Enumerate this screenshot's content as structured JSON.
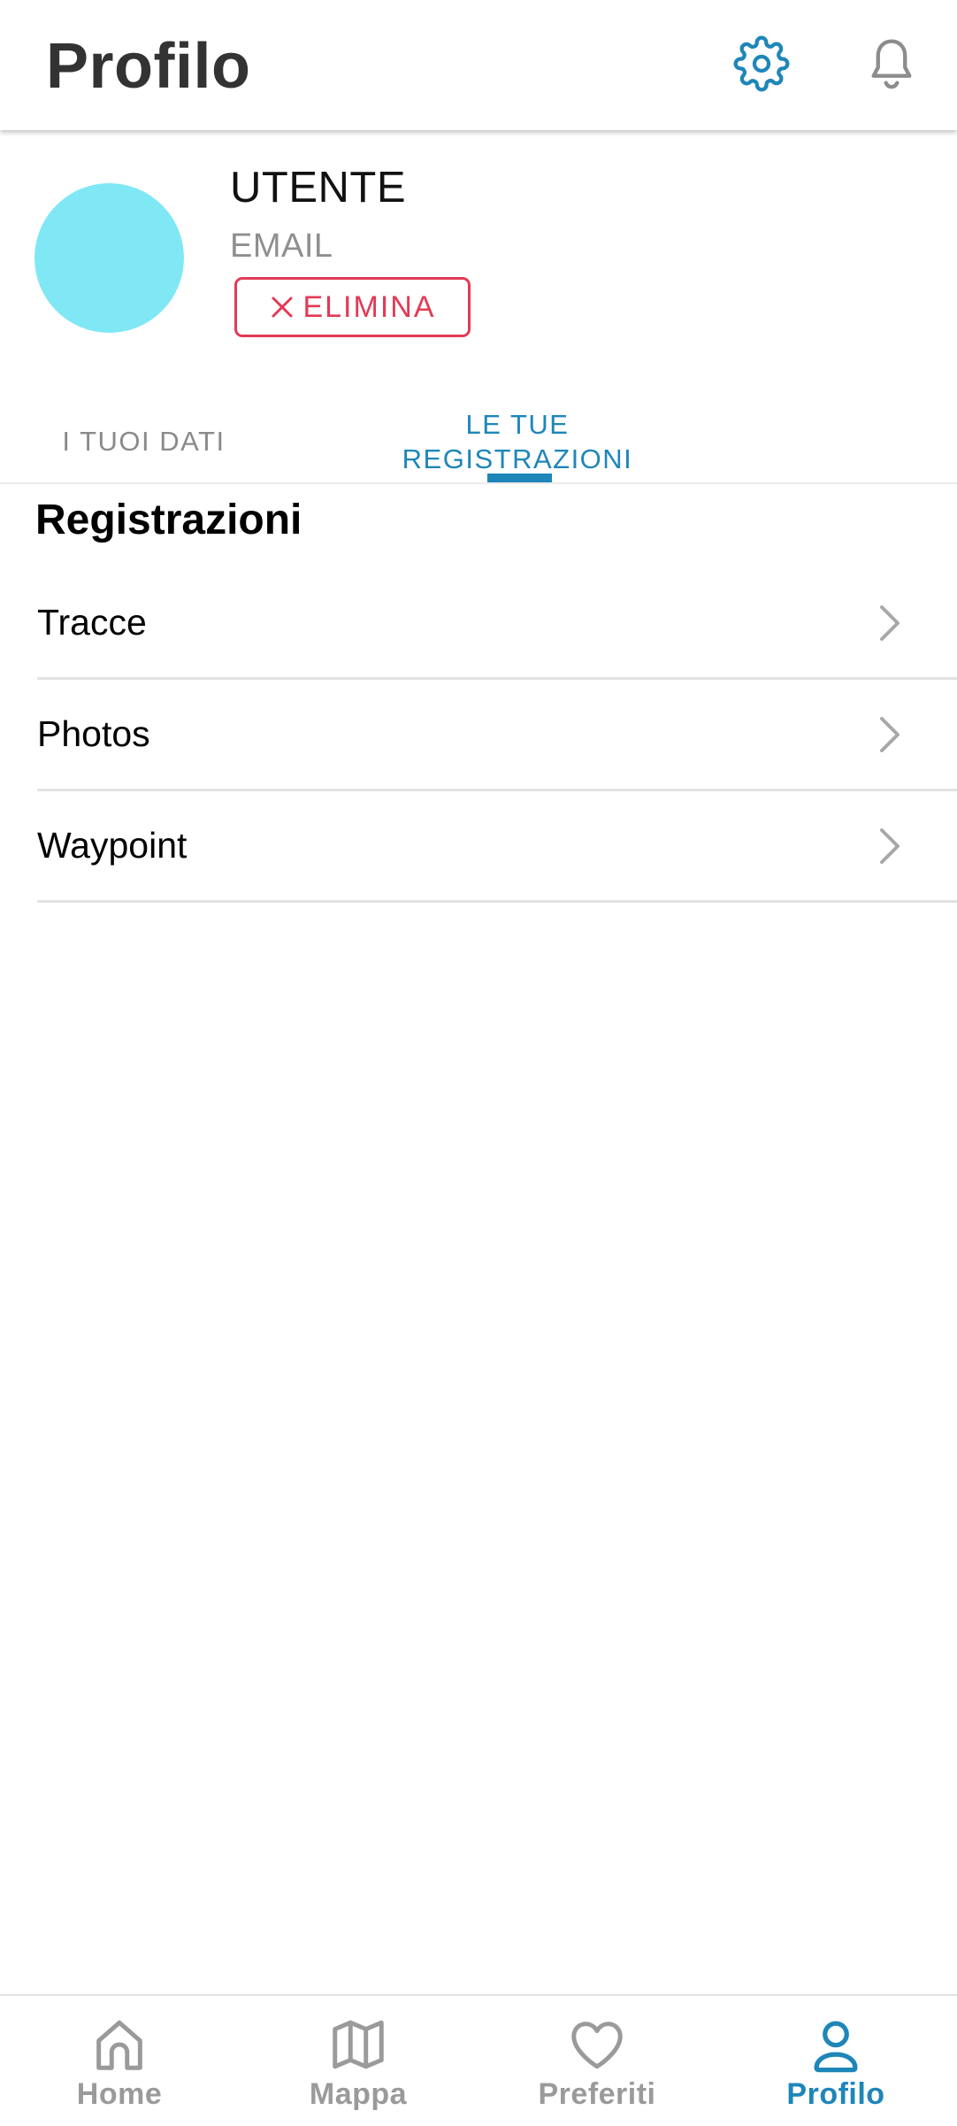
{
  "header": {
    "title": "Profilo",
    "icons": {
      "settings": "gear-icon",
      "notifications": "bell-icon"
    },
    "settings_color": "#1e86b9"
  },
  "profile": {
    "name": "UTENTE",
    "email": "EMAIL",
    "delete_label": "ELIMINA",
    "avatar_color": "#7fe8f4",
    "delete_color": "#e23a55"
  },
  "tabs": [
    {
      "label": "I TUOI DATI",
      "active": false
    },
    {
      "label_line1": "LE TUE",
      "label_line2": "REGISTRAZIONI",
      "active": true
    }
  ],
  "section": {
    "title": "Registrazioni",
    "items": [
      {
        "label": "Tracce"
      },
      {
        "label": "Photos"
      },
      {
        "label": "Waypoint"
      }
    ]
  },
  "bottom_nav": {
    "items": [
      {
        "label": "Home",
        "icon": "home-icon",
        "active": false
      },
      {
        "label": "Mappa",
        "icon": "map-icon",
        "active": false
      },
      {
        "label": "Preferiti",
        "icon": "heart-icon",
        "active": false
      },
      {
        "label": "Profilo",
        "icon": "user-icon",
        "active": true
      }
    ],
    "active_color": "#1e86b9",
    "inactive_color": "#9a9a9a"
  }
}
